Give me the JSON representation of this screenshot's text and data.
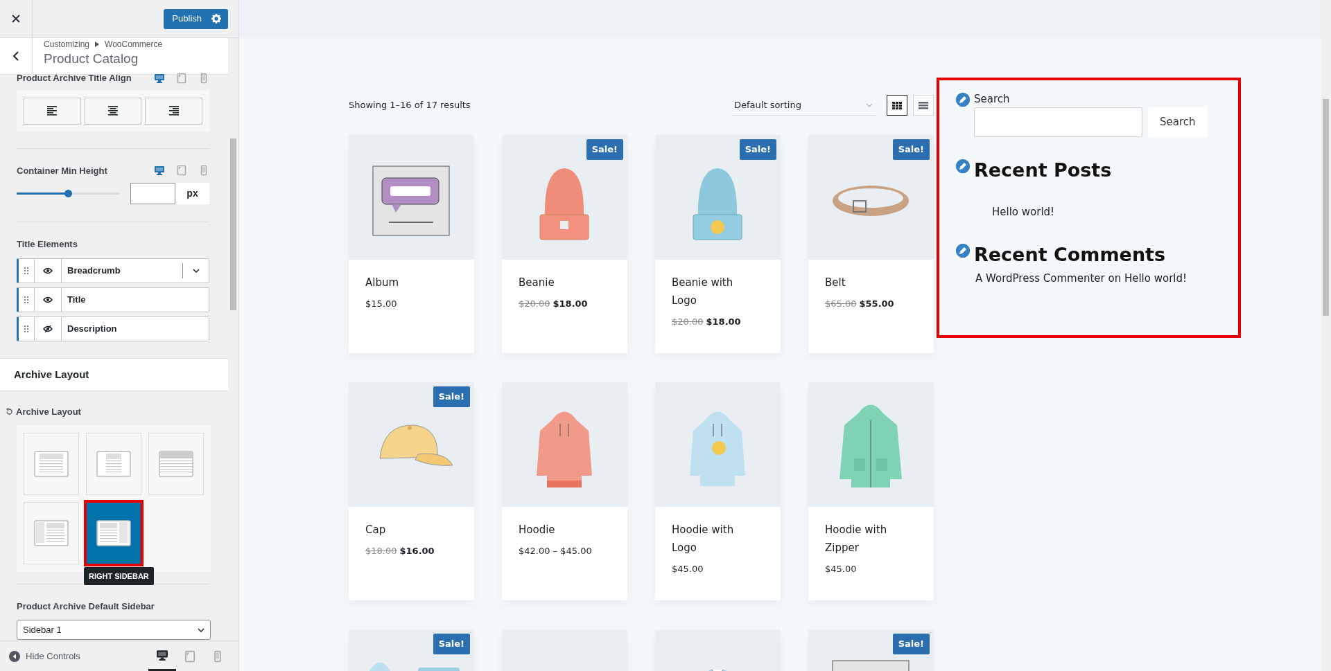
{
  "panel": {
    "publish_button": "Publish",
    "breadcrumb": {
      "parent": "Customizing",
      "current": "WooCommerce"
    },
    "section_title": "Product Catalog",
    "title_align": {
      "label": "Product Archive Title Align",
      "devices": [
        {
          "kind": "desktop",
          "selected": true
        },
        {
          "kind": "tablet",
          "selected": false
        },
        {
          "kind": "mobile",
          "selected": false
        }
      ],
      "options": [
        {
          "kind": "left"
        },
        {
          "kind": "center"
        },
        {
          "kind": "right"
        }
      ]
    },
    "min_height": {
      "label": "Container Min Height",
      "devices": [
        {
          "kind": "desktop",
          "selected": true
        },
        {
          "kind": "tablet",
          "selected": false
        },
        {
          "kind": "mobile",
          "selected": false
        }
      ],
      "level": 0.5,
      "unit": "px"
    },
    "title_elements": {
      "label": "Title Elements",
      "items": [
        {
          "label": "Breadcrumb",
          "visible": true,
          "expandable": true
        },
        {
          "label": "Title",
          "visible": true,
          "expandable": false
        },
        {
          "label": "Description",
          "visible": false,
          "expandable": false
        }
      ]
    },
    "layout_section": "Archive Layout",
    "archive_layout": {
      "label": "Archive Layout",
      "options": [
        {
          "kind": "normal",
          "selected": false,
          "highlighted": false
        },
        {
          "kind": "narrow",
          "selected": false,
          "highlighted": false
        },
        {
          "kind": "fullwidth",
          "selected": false,
          "highlighted": false
        },
        {
          "kind": "leftsidebar",
          "selected": false,
          "highlighted": false
        },
        {
          "kind": "rightsidebar",
          "selected": true,
          "highlighted": true
        }
      ],
      "tooltip": "RIGHT SIDEBAR"
    },
    "default_sidebar": {
      "label": "Product Archive Default Sidebar",
      "value": "Sidebar 1"
    },
    "footer": {
      "hide_controls": "Hide Controls",
      "devices": [
        {
          "kind": "desktop",
          "selected": true
        },
        {
          "kind": "tablet",
          "selected": false
        },
        {
          "kind": "mobile",
          "selected": false
        }
      ]
    }
  },
  "preview": {
    "result_count": "Showing 1–16 of 17 results",
    "sorting": "Default sorting",
    "views": [
      {
        "kind": "grid",
        "selected": true
      },
      {
        "kind": "list",
        "selected": false
      }
    ],
    "products": [
      {
        "kind": "product",
        "name": "Album",
        "price": "$15.00"
      },
      {
        "kind": "product",
        "name": "Beanie",
        "badge": "Sale!",
        "old_price": "$20.00",
        "price": "$18.00"
      },
      {
        "kind": "product",
        "name": "Beanie with Logo",
        "badge": "Sale!",
        "old_price": "$20.00",
        "price": "$18.00"
      },
      {
        "kind": "product",
        "name": "Belt",
        "badge": "Sale!",
        "old_price": "$65.00",
        "price": "$55.00"
      },
      {
        "kind": "product",
        "name": "Cap",
        "badge": "Sale!",
        "old_price": "$18.00",
        "price": "$16.00"
      },
      {
        "kind": "product",
        "name": "Hoodie",
        "price": "$42.00 – $45.00"
      },
      {
        "kind": "product",
        "name": "Hoodie with Logo",
        "price": "$45.00"
      },
      {
        "kind": "product",
        "name": "Hoodie with Zipper",
        "price": "$45.00"
      },
      {
        "kind": "product",
        "badge": "Sale!"
      },
      {
        "kind": "product"
      },
      {
        "kind": "product"
      },
      {
        "kind": "product",
        "badge": "Sale!"
      }
    ],
    "widgets": {
      "highlighted": true,
      "search": {
        "label": "Search",
        "button": "Search"
      },
      "recent_posts": {
        "title": "Recent Posts",
        "items": [
          "Hello world!"
        ]
      },
      "recent_comments": {
        "title": "Recent Comments",
        "items": [
          "A WordPress Commenter on Hello world!"
        ]
      }
    }
  }
}
